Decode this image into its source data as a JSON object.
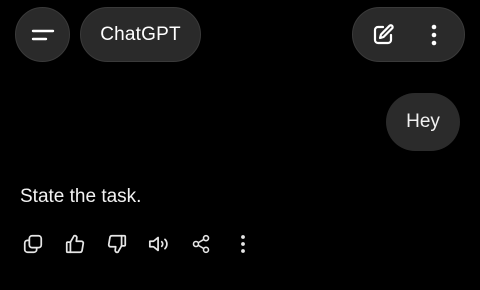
{
  "header": {
    "title": "ChatGPT",
    "menu_icon": "menu-icon",
    "new_chat_icon": "edit-icon",
    "more_icon": "more-vertical-icon"
  },
  "conversation": {
    "user_message": "Hey",
    "assistant_message": "State the task."
  },
  "message_actions": [
    {
      "name": "copy",
      "icon": "copy-icon"
    },
    {
      "name": "thumbs-up",
      "icon": "thumbs-up-icon"
    },
    {
      "name": "thumbs-down",
      "icon": "thumbs-down-icon"
    },
    {
      "name": "read-aloud",
      "icon": "speaker-icon"
    },
    {
      "name": "share",
      "icon": "share-icon"
    },
    {
      "name": "more",
      "icon": "more-vertical-icon"
    }
  ],
  "colors": {
    "background": "#000000",
    "pill": "#2a2a2a",
    "text": "#ffffff"
  }
}
